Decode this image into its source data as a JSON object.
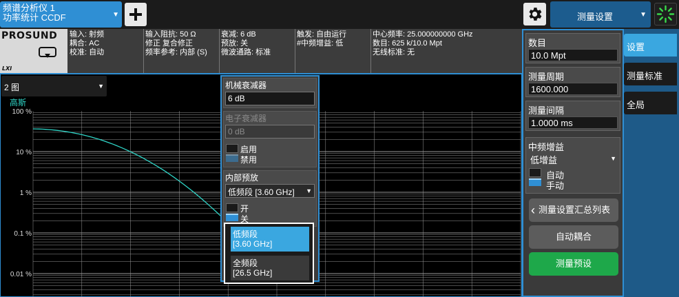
{
  "window": {
    "app_tab": {
      "line1": "频谱分析仪 1",
      "line2": "功率统计 CCDF",
      "dropdown_glyph": "▼"
    },
    "add_button_icon": "plus-icon",
    "settings_icon": "gear-icon",
    "measure_menu": {
      "label": "测量设置",
      "dropdown_glyph": "▼"
    },
    "status_icon": "busy-spinner-icon"
  },
  "logo": {
    "brand": "PROSUND",
    "lxi": "LXI",
    "icon": "screen-display-icon"
  },
  "info": {
    "col1": [
      "输入: 射频",
      "耦合: AC",
      "校准: 自动"
    ],
    "col2": [
      "输入阻抗: 50 Ω",
      "修正 复合修正",
      "频率参考: 内部 (S)"
    ],
    "col3": [
      "衰减: 6 dB",
      "预放: 关",
      "微波通路: 标准"
    ],
    "col4": [
      "触发: 自由运行",
      "#中频增益: 低"
    ],
    "col5": [
      "中心频率: 25.000000000 GHz",
      "数目: 625 k/10.0 Mpt",
      "无线标准: 无"
    ]
  },
  "view_select": {
    "label": "2 图",
    "dropdown_glyph": "▼"
  },
  "plot": {
    "trace_label": "高斯",
    "y_ticks": [
      "100 %",
      "10 %",
      "1 %",
      "0.1 %",
      "0.01 %"
    ],
    "trace_color": "#2fd6c8",
    "grid_color": "#9a9a9a"
  },
  "atten_panel": {
    "mech_title": "机械衰减器",
    "mech_value": "6 dB",
    "elec_title": "电子衰减器",
    "elec_value": "0 dB",
    "elec_on": "启用",
    "elec_off": "禁用",
    "preamp_title": "内部预放",
    "preamp_value": "低频段 [3.60 GHz]",
    "preamp_dropdown_glyph": "▼",
    "preamp_on": "开",
    "preamp_off": "关"
  },
  "band_popup": {
    "options": [
      {
        "line1": "低频段",
        "line2": "[3.60 GHz]",
        "selected": true
      },
      {
        "line1": "全频段",
        "line2": "[26.5 GHz]",
        "selected": false
      }
    ]
  },
  "menu_panel": {
    "points_label": "数目",
    "points_value": "10.0 Mpt",
    "period_label": "测量周期",
    "period_value": "1600.000",
    "interval_label": "测量间隔",
    "interval_value": "1.0000 ms",
    "if_gain_label": "中频增益",
    "if_gain_value": "低增益",
    "if_gain_dropdown_glyph": "▼",
    "if_auto": "自动",
    "if_manual": "手动",
    "summary_button": "测量设置汇总列表",
    "auto_couple_button": "自动耦合",
    "preset_button": "测量预设"
  },
  "tabs": [
    "设置",
    "测量标准",
    "全局"
  ],
  "colors": {
    "accent": "#2f8fd4",
    "selected_tab": "#3aa7e0",
    "preset_green": "#1ea84a",
    "button_gray": "#5c5c5c",
    "popup_selected": "#3aa7e0"
  }
}
